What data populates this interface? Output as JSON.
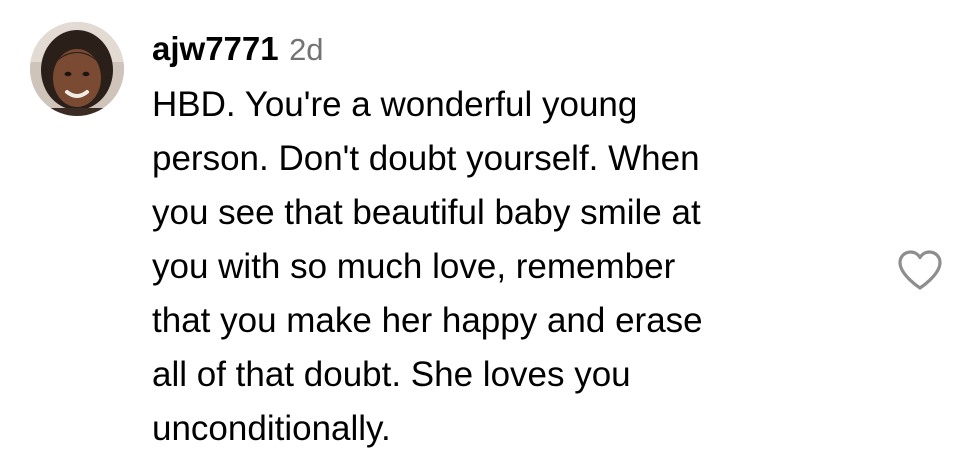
{
  "comment": {
    "username": "ajw7771",
    "timestamp": "2d",
    "text": "HBD. You're a wonderful young\nperson. Don't doubt yourself. When\nyou see that beautiful baby smile at\nyou with so much love, remember\nthat you make her happy and erase\nall of that doubt. She loves you\nunconditionally.",
    "avatar_icon": "user-profile-photo",
    "like_icon": "heart-outline-icon"
  },
  "colors": {
    "text": "#000000",
    "timestamp": "#737373",
    "icon_stroke": "#8e8e8e"
  }
}
